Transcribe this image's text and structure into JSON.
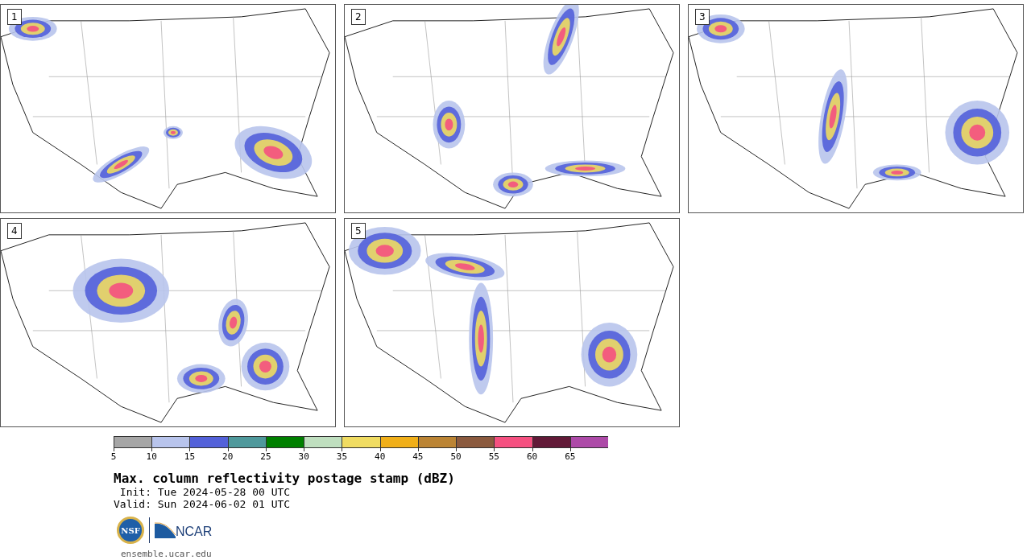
{
  "panels": [
    {
      "label": "1"
    },
    {
      "label": "2"
    },
    {
      "label": "3"
    },
    {
      "label": "4"
    },
    {
      "label": "5"
    }
  ],
  "colorbar": {
    "segments": [
      {
        "color": "#a6a6a6",
        "label": "5"
      },
      {
        "color": "#b8c4ec",
        "label": "10"
      },
      {
        "color": "#5361d9",
        "label": "15"
      },
      {
        "color": "#4f999c",
        "label": "20"
      },
      {
        "color": "#008000",
        "label": "25"
      },
      {
        "color": "#bfdfbf",
        "label": "30"
      },
      {
        "color": "#f0dc62",
        "label": "35"
      },
      {
        "color": "#f0af19",
        "label": "40"
      },
      {
        "color": "#bb8434",
        "label": "45"
      },
      {
        "color": "#8b5a3e",
        "label": "50"
      },
      {
        "color": "#f55080",
        "label": "55"
      },
      {
        "color": "#621a38",
        "label": "60"
      },
      {
        "color": "#ad4aa8",
        "label": "65"
      }
    ]
  },
  "title": "Max. column reflectivity postage stamp (dBZ)",
  "init": " Init: Tue 2024-05-28 00 UTC",
  "valid": "Valid: Sun 2024-06-02 01 UTC",
  "logos": {
    "nsf": "NSF",
    "ncar": "NCAR"
  },
  "footer": "ensemble.ucar.edu"
}
